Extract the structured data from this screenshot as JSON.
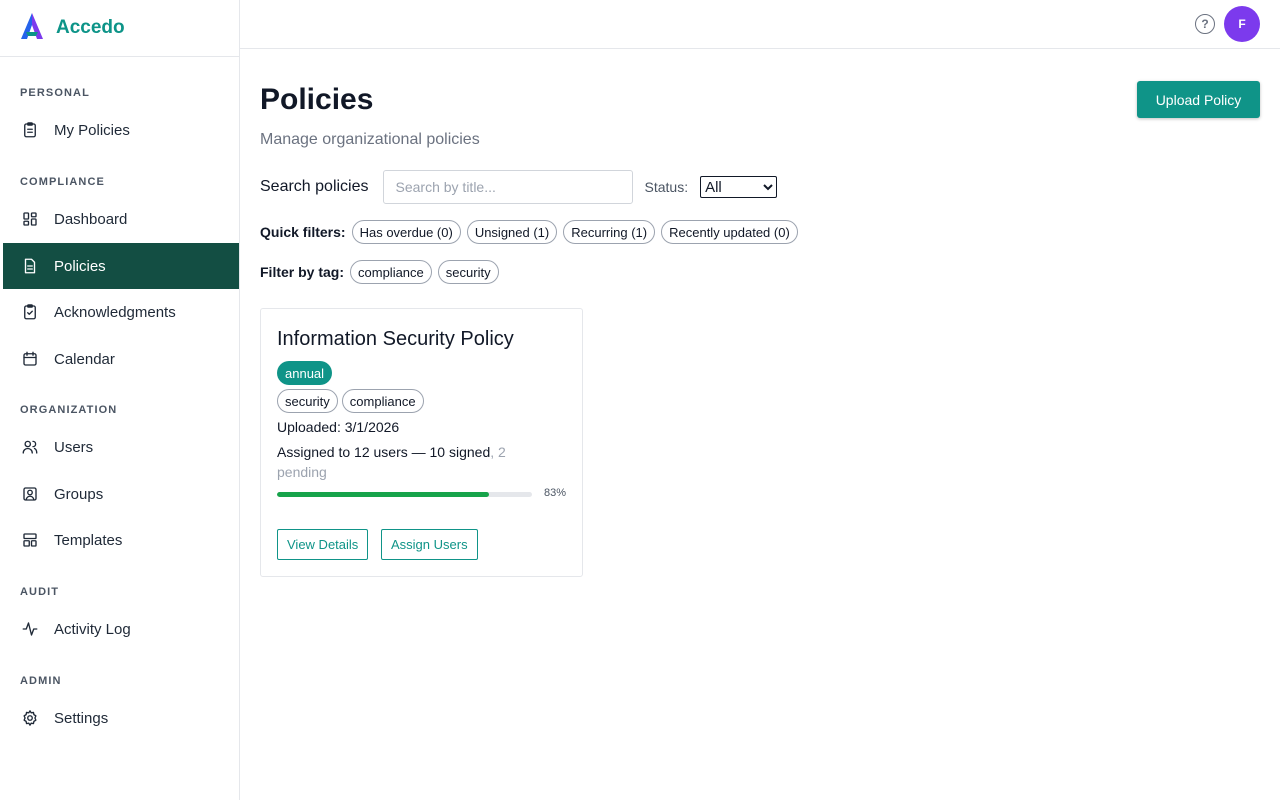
{
  "app": {
    "name": "Accedo",
    "accent": "#0d9488",
    "nav_active_bg": "#134e43"
  },
  "sidebar": {
    "sections": [
      {
        "label": "PERSONAL",
        "items": [
          {
            "label": "My Policies",
            "icon": "clipboard-list-icon"
          }
        ]
      },
      {
        "label": "COMPLIANCE",
        "items": [
          {
            "label": "Dashboard",
            "icon": "dashboard-icon"
          },
          {
            "label": "Policies",
            "icon": "document-icon",
            "active": true
          },
          {
            "label": "Acknowledgments",
            "icon": "clipboard-check-icon"
          },
          {
            "label": "Calendar",
            "icon": "calendar-icon"
          }
        ]
      },
      {
        "label": "ORGANIZATION",
        "items": [
          {
            "label": "Users",
            "icon": "users-icon"
          },
          {
            "label": "Groups",
            "icon": "user-square-icon"
          },
          {
            "label": "Templates",
            "icon": "template-icon"
          }
        ]
      },
      {
        "label": "AUDIT",
        "items": [
          {
            "label": "Activity Log",
            "icon": "activity-icon"
          }
        ]
      },
      {
        "label": "ADMIN",
        "items": [
          {
            "label": "Settings",
            "icon": "gear-icon"
          }
        ]
      }
    ]
  },
  "header": {
    "help_icon": "question-circle-icon",
    "help_glyph": "?",
    "avatar_initial": "F",
    "avatar_color": "#7c3aed"
  },
  "page": {
    "title": "Policies",
    "subtitle": "Manage organizational policies",
    "upload_button": "Upload Policy"
  },
  "search": {
    "label": "Search policies",
    "placeholder": "Search by title...",
    "value": "",
    "status_label": "Status:",
    "status_value": "All"
  },
  "quick_filters": {
    "label": "Quick filters:",
    "chips": [
      "Has overdue (0)",
      "Unsigned (1)",
      "Recurring (1)",
      "Recently updated (0)"
    ]
  },
  "tag_filters": {
    "label": "Filter by tag:",
    "chips": [
      "compliance",
      "security"
    ]
  },
  "policies": [
    {
      "title": "Information Security Policy",
      "frequency": "annual",
      "tags": [
        "security",
        "compliance"
      ],
      "uploaded": "Uploaded: 3/1/2026",
      "assigned_text": "Assigned to 12 users — 10 signed",
      "pending_text": ", 2 pending",
      "progress_percent": 83,
      "progress_label": "83%",
      "progress_color": "#16a34a",
      "view_button": "View Details",
      "assign_button": "Assign Users"
    }
  ]
}
